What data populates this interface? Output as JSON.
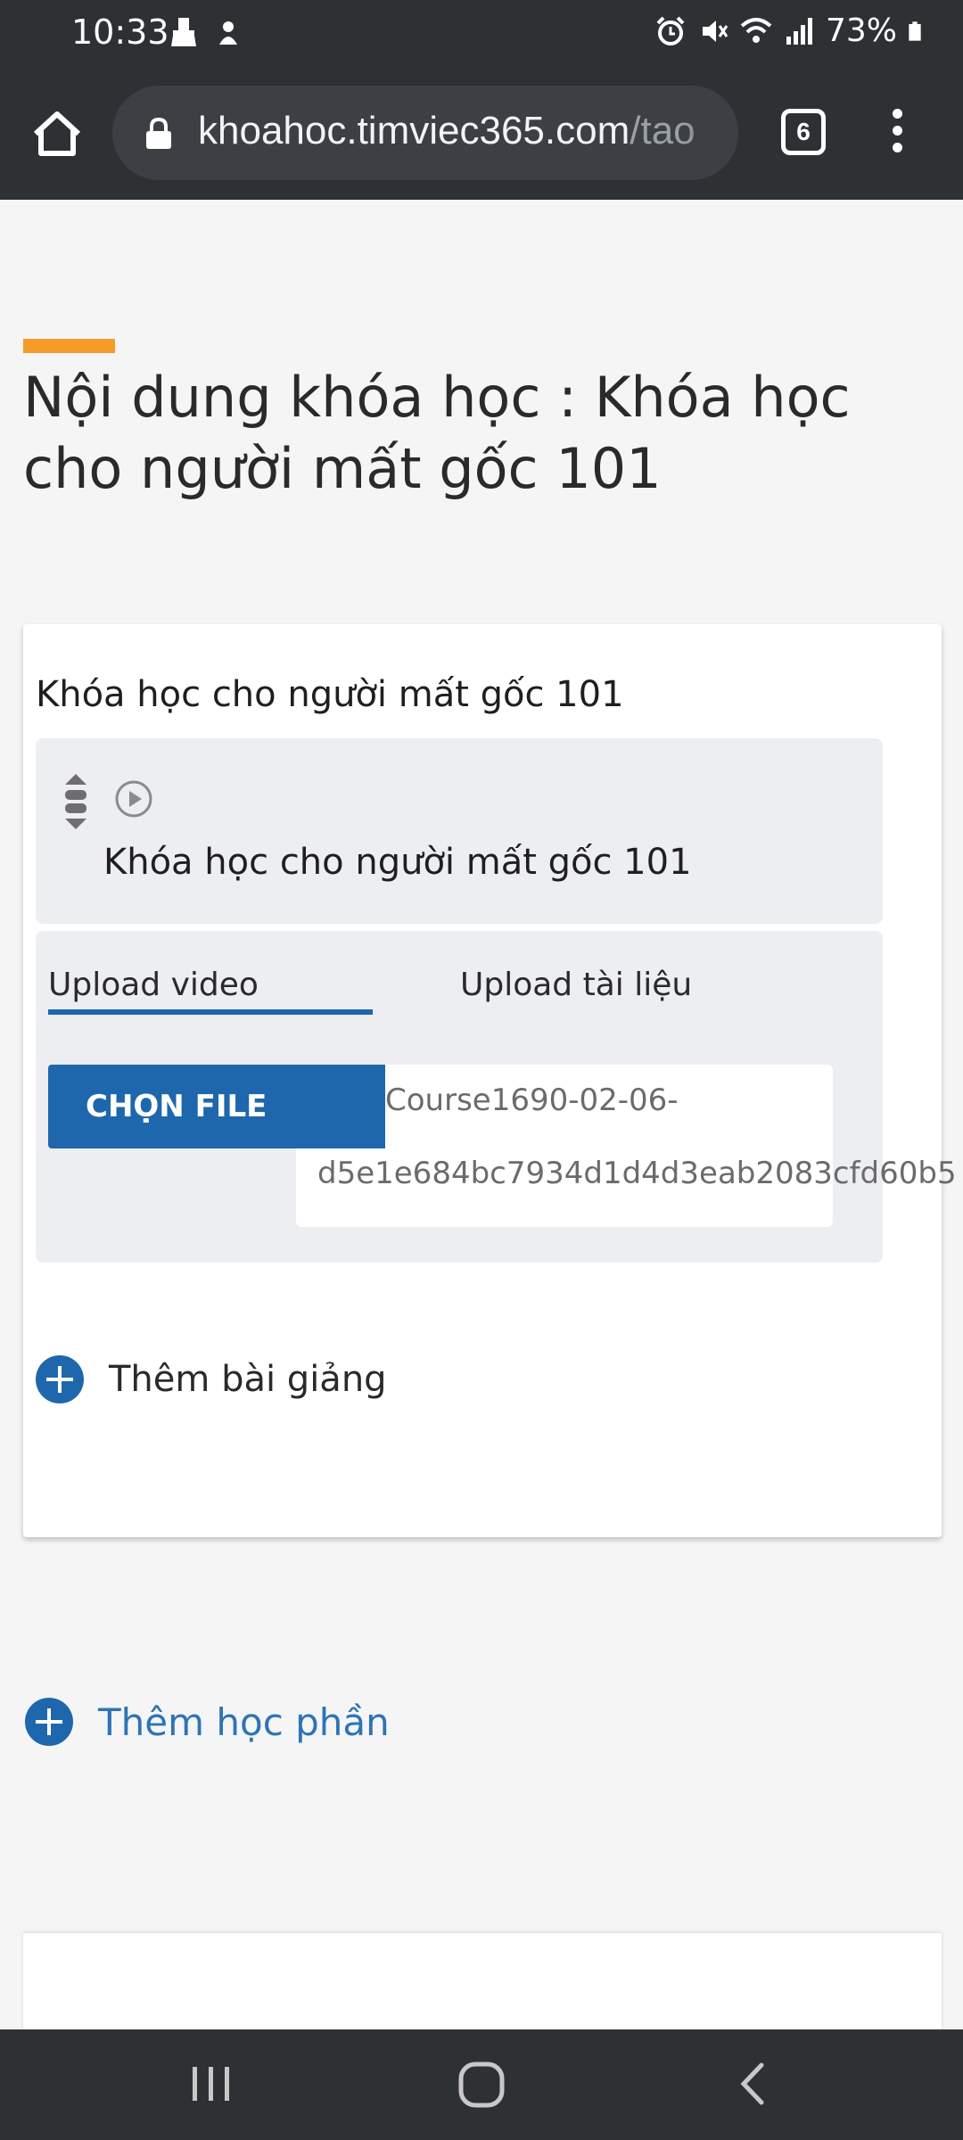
{
  "status_bar": {
    "time": "10:33",
    "battery": "73%",
    "left_icons": [
      "cleaner-icon",
      "sync-icon"
    ],
    "right_icons": [
      "alarm-icon",
      "mute-icon",
      "wifi-icon",
      "signal-icon",
      "battery-icon"
    ]
  },
  "browser": {
    "url_host": "khoahoc.timviec365.com",
    "url_path": "/tao",
    "tab_count": "6"
  },
  "page": {
    "title": "Nội dung khóa học : Khóa học cho người mất gốc 101",
    "accent_color": "#f59c27"
  },
  "section": {
    "title": "Khóa học cho người mất gốc 101",
    "lesson": {
      "title": "Khóa học cho người mất gốc 101",
      "tabs": [
        "Upload video",
        "Upload tài liệu"
      ],
      "active_tab": "Upload video",
      "choose_file_label": "CHỌN FILE",
      "file_name_line1": "Course1690-02-06-",
      "file_name_line2": "d5e1e684bc7934d1d4d3eab2083cfd60b5"
    },
    "add_lecture_label": "Thêm bài giảng"
  },
  "add_section_label": "Thêm học phần",
  "colors": {
    "primary": "#1f67ad",
    "link": "#2e74b5",
    "chrome_dark": "#2e3134"
  },
  "nav_bar": {
    "buttons": [
      "recents-icon",
      "home-icon",
      "back-icon"
    ]
  }
}
